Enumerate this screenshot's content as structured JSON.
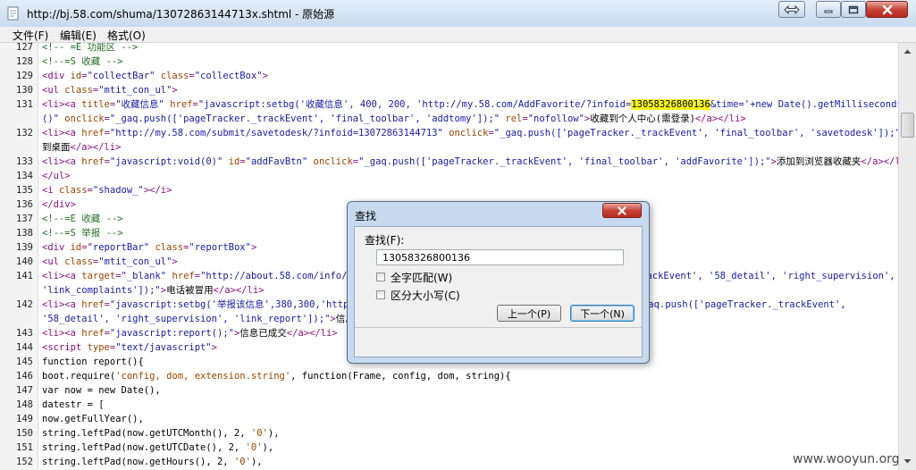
{
  "window": {
    "title": "http://bj.58.com/shuma/13072863144713x.shtml - 原始源"
  },
  "menu": [
    "文件(F)",
    "编辑(E)",
    "格式(O)"
  ],
  "lines": [
    {
      "n": "127",
      "segs": [
        {
          "c": "c",
          "t": "<!-- =E 功能区 -->"
        }
      ]
    },
    {
      "n": "128",
      "segs": [
        {
          "c": "c",
          "t": "<!--=S 收藏 -->"
        }
      ]
    },
    {
      "n": "129",
      "segs": [
        {
          "c": "t",
          "t": "<div "
        },
        {
          "c": "a",
          "t": "id"
        },
        {
          "c": "t",
          "t": "="
        },
        {
          "c": "v",
          "t": "\"collectBar\""
        },
        {
          "c": "t",
          "t": " "
        },
        {
          "c": "a",
          "t": "class"
        },
        {
          "c": "t",
          "t": "="
        },
        {
          "c": "v",
          "t": "\"collectBox\""
        },
        {
          "c": "t",
          "t": ">"
        }
      ]
    },
    {
      "n": "130",
      "segs": [
        {
          "c": "t",
          "t": "<ul "
        },
        {
          "c": "a",
          "t": "class"
        },
        {
          "c": "t",
          "t": "="
        },
        {
          "c": "v",
          "t": "\"mtit_con_ul\""
        },
        {
          "c": "t",
          "t": ">"
        }
      ]
    },
    {
      "n": "131",
      "segs": [
        {
          "c": "t",
          "t": "<li><a "
        },
        {
          "c": "a",
          "t": "title"
        },
        {
          "c": "t",
          "t": "="
        },
        {
          "c": "v",
          "t": "\"收藏信息\""
        },
        {
          "c": "t",
          "t": " "
        },
        {
          "c": "a",
          "t": "href"
        },
        {
          "c": "t",
          "t": "="
        },
        {
          "c": "v",
          "t": "\"javascript:setbg('收藏信息', 400, 200, 'http://my.58.com/AddFavorite/?infoid="
        },
        {
          "c": "hl",
          "t": "13058326800136"
        },
        {
          "c": "v",
          "t": "&time='+new Date().getMilliseconds"
        }
      ]
    },
    {
      "n": "",
      "segs": [
        {
          "c": "v",
          "t": "()\""
        },
        {
          "c": "t",
          "t": " "
        },
        {
          "c": "a",
          "t": "onclick"
        },
        {
          "c": "t",
          "t": "="
        },
        {
          "c": "v",
          "t": "\"_gaq.push(['pageTracker._trackEvent', 'final_toolbar', 'addtomy']);\""
        },
        {
          "c": "t",
          "t": " "
        },
        {
          "c": "a",
          "t": "rel"
        },
        {
          "c": "t",
          "t": "="
        },
        {
          "c": "v",
          "t": "\"nofollow\""
        },
        {
          "c": "t",
          "t": ">"
        },
        {
          "c": "x",
          "t": "收藏到个人中心(需登录)"
        },
        {
          "c": "t",
          "t": "</a></li>"
        }
      ]
    },
    {
      "n": "132",
      "segs": [
        {
          "c": "t",
          "t": "<li><a "
        },
        {
          "c": "a",
          "t": "href"
        },
        {
          "c": "t",
          "t": "="
        },
        {
          "c": "v",
          "t": "\"http://my.58.com/submit/savetodesk/?infoid=13072863144713\""
        },
        {
          "c": "t",
          "t": " "
        },
        {
          "c": "a",
          "t": "onclick"
        },
        {
          "c": "t",
          "t": "="
        },
        {
          "c": "v",
          "t": "\"_gaq.push(['pageTracker._trackEvent', 'final_toolbar', 'savetodesk']);\""
        },
        {
          "c": "t",
          "t": ">"
        },
        {
          "c": "x",
          "t": "保存"
        }
      ]
    },
    {
      "n": "",
      "segs": [
        {
          "c": "x",
          "t": "到桌面"
        },
        {
          "c": "t",
          "t": "</a></li>"
        }
      ]
    },
    {
      "n": "133",
      "segs": [
        {
          "c": "t",
          "t": "<li><a "
        },
        {
          "c": "a",
          "t": "href"
        },
        {
          "c": "t",
          "t": "="
        },
        {
          "c": "v",
          "t": "\"javascript:void(0)\""
        },
        {
          "c": "t",
          "t": " "
        },
        {
          "c": "a",
          "t": "id"
        },
        {
          "c": "t",
          "t": "="
        },
        {
          "c": "v",
          "t": "\"addFavBtn\""
        },
        {
          "c": "t",
          "t": " "
        },
        {
          "c": "a",
          "t": "onclick"
        },
        {
          "c": "t",
          "t": "="
        },
        {
          "c": "v",
          "t": "\"_gaq.push(['pageTracker._trackEvent', 'final_toolbar', 'addFavorite']);\""
        },
        {
          "c": "t",
          "t": ">"
        },
        {
          "c": "x",
          "t": "添加到浏览器收藏夹"
        },
        {
          "c": "t",
          "t": "</a></li>"
        }
      ]
    },
    {
      "n": "134",
      "segs": [
        {
          "c": "t",
          "t": "</ul>"
        }
      ]
    },
    {
      "n": "135",
      "segs": [
        {
          "c": "t",
          "t": "<i "
        },
        {
          "c": "a",
          "t": "class"
        },
        {
          "c": "t",
          "t": "="
        },
        {
          "c": "v",
          "t": "\"shadow_\""
        },
        {
          "c": "t",
          "t": "></i>"
        }
      ]
    },
    {
      "n": "136",
      "segs": [
        {
          "c": "t",
          "t": "</div>"
        }
      ]
    },
    {
      "n": "137",
      "segs": [
        {
          "c": "c",
          "t": "<!--=E 收藏 -->"
        }
      ]
    },
    {
      "n": "138",
      "segs": [
        {
          "c": "c",
          "t": "<!--=S 举报 -->"
        }
      ]
    },
    {
      "n": "139",
      "segs": [
        {
          "c": "t",
          "t": "<div "
        },
        {
          "c": "a",
          "t": "id"
        },
        {
          "c": "t",
          "t": "="
        },
        {
          "c": "v",
          "t": "\"reportBar\""
        },
        {
          "c": "t",
          "t": " "
        },
        {
          "c": "a",
          "t": "class"
        },
        {
          "c": "t",
          "t": "="
        },
        {
          "c": "v",
          "t": "\"reportBox\""
        },
        {
          "c": "t",
          "t": ">"
        }
      ]
    },
    {
      "n": "140",
      "segs": [
        {
          "c": "t",
          "t": "<ul "
        },
        {
          "c": "a",
          "t": "class"
        },
        {
          "c": "t",
          "t": "="
        },
        {
          "c": "v",
          "t": "\"mtit_con_ul\""
        },
        {
          "c": "t",
          "t": ">"
        }
      ]
    },
    {
      "n": "141",
      "segs": [
        {
          "c": "t",
          "t": "<li><a "
        },
        {
          "c": "a",
          "t": "target"
        },
        {
          "c": "t",
          "t": "="
        },
        {
          "c": "v",
          "t": "\"_blank\""
        },
        {
          "c": "t",
          "t": " "
        },
        {
          "c": "a",
          "t": "href"
        },
        {
          "c": "t",
          "t": "="
        },
        {
          "c": "v",
          "t": "\"http://about.58.com/info/deleteinfo.aspx\" onclick=\"_gaq.push(['pageTracker._trackEvent', '58_detail', 'right_supervision',"
        }
      ]
    },
    {
      "n": "",
      "segs": [
        {
          "c": "v",
          "t": "'link_complaints']);\""
        },
        {
          "c": "t",
          "t": ">"
        },
        {
          "c": "x",
          "t": "电话被冒用"
        },
        {
          "c": "t",
          "t": "</a></li>"
        }
      ]
    },
    {
      "n": "142",
      "segs": [
        {
          "c": "t",
          "t": "<li><a "
        },
        {
          "c": "a",
          "t": "href"
        },
        {
          "c": "t",
          "t": "="
        },
        {
          "c": "v",
          "t": "\"javascript:setbg('举报该信息',380,300,'http://about.58.com/report/13072863144713');\" onclick=\"_gaq.push(['pageTracker._trackEvent',"
        }
      ]
    },
    {
      "n": "",
      "segs": [
        {
          "c": "v",
          "t": "'58_detail', 'right_supervision', 'link_report']);\""
        },
        {
          "c": "t",
          "t": ">"
        },
        {
          "c": "x",
          "t": "信息成交"
        },
        {
          "c": "t",
          "t": "</a></li>"
        }
      ]
    },
    {
      "n": "143",
      "segs": [
        {
          "c": "t",
          "t": "<li><a "
        },
        {
          "c": "a",
          "t": "href"
        },
        {
          "c": "t",
          "t": "="
        },
        {
          "c": "v",
          "t": "\"javascript:report();\""
        },
        {
          "c": "t",
          "t": ">"
        },
        {
          "c": "x",
          "t": "信息已成交"
        },
        {
          "c": "t",
          "t": "</a></li>"
        }
      ]
    },
    {
      "n": "144",
      "segs": [
        {
          "c": "t",
          "t": "<script "
        },
        {
          "c": "a",
          "t": "type"
        },
        {
          "c": "t",
          "t": "="
        },
        {
          "c": "v",
          "t": "\"text/javascript\""
        },
        {
          "c": "t",
          "t": ">"
        }
      ]
    },
    {
      "n": "145",
      "segs": [
        {
          "c": "x",
          "t": "function report(){"
        }
      ]
    },
    {
      "n": "146",
      "segs": [
        {
          "c": "x",
          "t": "boot.require("
        },
        {
          "c": "a",
          "t": "'config, dom, extension.string'"
        },
        {
          "c": "x",
          "t": ", function(Frame, config, dom, string){"
        }
      ]
    },
    {
      "n": "147",
      "segs": [
        {
          "c": "x",
          "t": "var now = new Date(),"
        }
      ]
    },
    {
      "n": "148",
      "segs": [
        {
          "c": "x",
          "t": "datestr = ["
        }
      ]
    },
    {
      "n": "149",
      "segs": [
        {
          "c": "x",
          "t": "now.getFullYear(),"
        }
      ]
    },
    {
      "n": "150",
      "segs": [
        {
          "c": "x",
          "t": "string.leftPad(now.getUTCMonth(), 2, "
        },
        {
          "c": "a",
          "t": "'0'"
        },
        {
          "c": "x",
          "t": "),"
        }
      ]
    },
    {
      "n": "151",
      "segs": [
        {
          "c": "x",
          "t": "string.leftPad(now.getUTCDate(), 2, "
        },
        {
          "c": "a",
          "t": "'0'"
        },
        {
          "c": "x",
          "t": "),"
        }
      ]
    },
    {
      "n": "152",
      "segs": [
        {
          "c": "x",
          "t": "string.leftPad(now.getHours(), 2, "
        },
        {
          "c": "a",
          "t": "'0'"
        },
        {
          "c": "x",
          "t": "),"
        }
      ]
    }
  ],
  "find_dialog": {
    "title": "查找",
    "find_label": "查找(F):",
    "find_value": "13058326800136",
    "whole_word_label": "全字匹配(W)",
    "match_case_label": "区分大小写(C)",
    "prev_button": "上一个(P)",
    "next_button": "下一个(N)"
  },
  "watermark": "www.wooyun.org"
}
